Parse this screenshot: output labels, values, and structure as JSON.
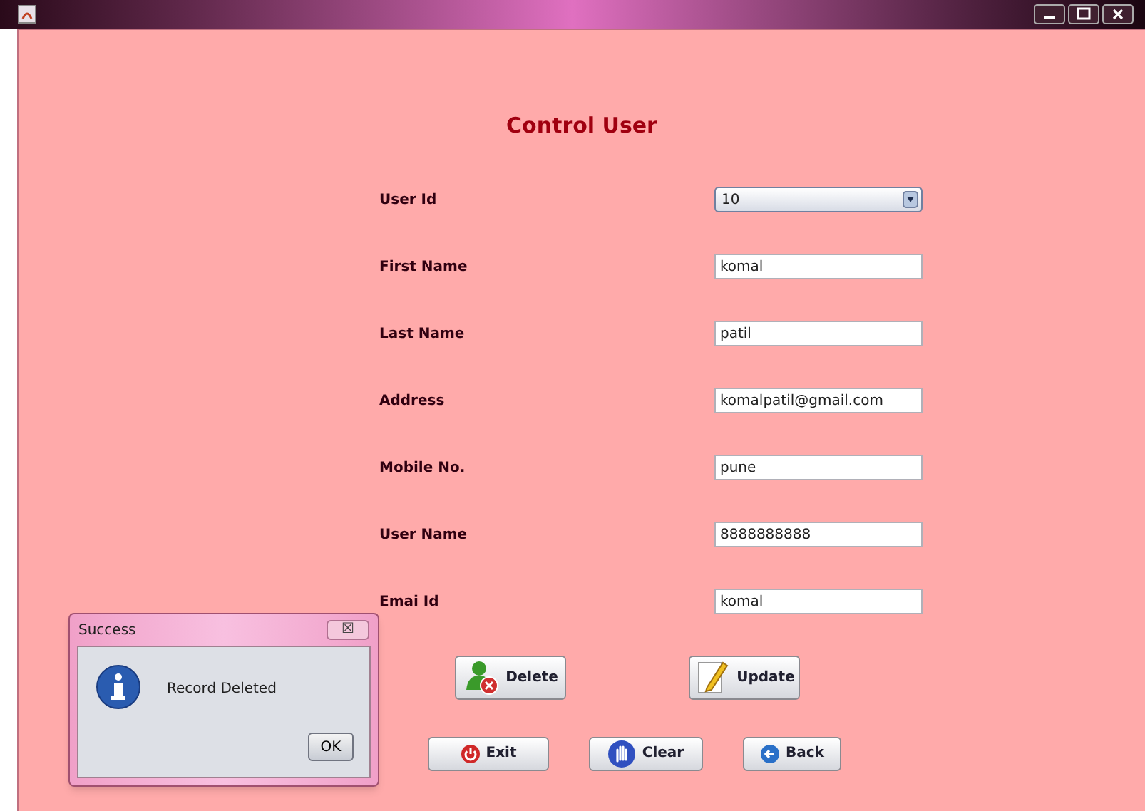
{
  "heading": "Control User",
  "fields": [
    {
      "label": "User Id",
      "kind": "dropdown",
      "value": "10"
    },
    {
      "label": "First Name",
      "kind": "text",
      "value": "komal"
    },
    {
      "label": "Last Name",
      "kind": "text",
      "value": "patil"
    },
    {
      "label": "Address",
      "kind": "text",
      "value": "komalpatil@gmail.com"
    },
    {
      "label": "Mobile No.",
      "kind": "text",
      "value": "pune"
    },
    {
      "label": "User Name",
      "kind": "text",
      "value": "8888888888"
    },
    {
      "label": "Emai Id",
      "kind": "text",
      "value": "komal"
    }
  ],
  "action_buttons": [
    {
      "label": "Delete",
      "kind": "delete"
    },
    {
      "label": "Update",
      "kind": "update"
    }
  ],
  "nav_buttons": [
    {
      "label": "Exit",
      "kind": "exit"
    },
    {
      "label": "Clear",
      "kind": "clear"
    },
    {
      "label": "Back",
      "kind": "back"
    }
  ],
  "dialog": {
    "title": "Success",
    "close": "☒",
    "message": "Record Deleted",
    "button": "OK"
  }
}
